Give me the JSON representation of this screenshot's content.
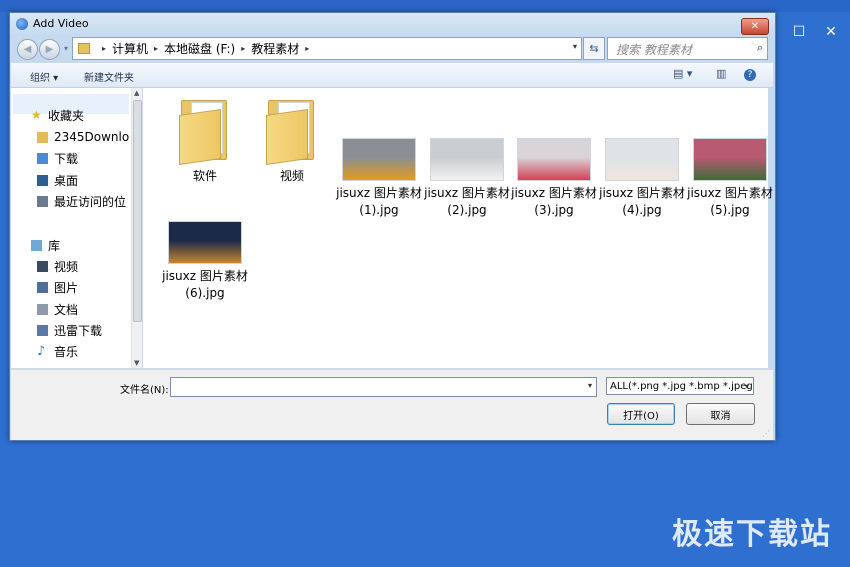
{
  "dialog": {
    "title": "Add Video",
    "close_glyph": "✕"
  },
  "nav_buttons": {
    "back": "◀",
    "forward": "▶",
    "dropdown": "▾"
  },
  "address": {
    "crumbs": [
      "计算机",
      "本地磁盘 (F:)",
      "教程素材"
    ],
    "separator": "▸",
    "dropdown": "▾"
  },
  "refresh_glyph": "⇆",
  "search": {
    "placeholder": "搜索 教程素材",
    "icon": "search-icon"
  },
  "toolbar": {
    "organize": "组织 ▾",
    "new_folder": "新建文件夹",
    "view_icon": "▤ ▾",
    "pane_icon": "▥",
    "help_icon": "?"
  },
  "nav_tree": [
    {
      "label": "收藏夹",
      "icon": "star-icon",
      "color": "#e7b525",
      "top": true
    },
    {
      "label": "2345Downlo",
      "icon": "folder-icon",
      "color": "#e2bd55"
    },
    {
      "label": "下载",
      "icon": "download-folder-icon",
      "color": "#4a8cd1"
    },
    {
      "label": "桌面",
      "icon": "desktop-icon",
      "color": "#2f5d95"
    },
    {
      "label": "最近访问的位",
      "icon": "recent-places-icon",
      "color": "#6b7a8e"
    },
    {
      "label": "库",
      "icon": "libraries-icon",
      "color": "#6fa9d6",
      "top": true
    },
    {
      "label": "视频",
      "icon": "videos-icon",
      "color": "#3a4a5f"
    },
    {
      "label": "图片",
      "icon": "pictures-icon",
      "color": "#4e6f9a"
    },
    {
      "label": "文档",
      "icon": "documents-icon",
      "color": "#8e9aa9"
    },
    {
      "label": "迅雷下载",
      "icon": "thunder-folder-icon",
      "color": "#5c79a6"
    },
    {
      "label": "音乐",
      "icon": "music-icon",
      "color": "#2a79d2"
    }
  ],
  "files": [
    {
      "label": "软件",
      "kind": "folder"
    },
    {
      "label": "视频",
      "kind": "folder"
    },
    {
      "label": "jisuxz 图片素材 (1).jpg",
      "kind": "image",
      "colors": [
        "#8a8f95",
        "#e39a1c"
      ]
    },
    {
      "label": "jisuxz 图片素材 (2).jpg",
      "kind": "image",
      "colors": [
        "#c9ccd0",
        "#f2f2f2"
      ]
    },
    {
      "label": "jisuxz 图片素材 (3).jpg",
      "kind": "image",
      "colors": [
        "#d9d4d9",
        "#d14054"
      ]
    },
    {
      "label": "jisuxz 图片素材 (4).jpg",
      "kind": "image",
      "colors": [
        "#dfe3e6",
        "#f1e4de"
      ]
    },
    {
      "label": "jisuxz 图片素材 (5).jpg",
      "kind": "image",
      "colors": [
        "#b85a72",
        "#3e6a3a"
      ]
    },
    {
      "label": "jisuxz 图片素材 (6).jpg",
      "kind": "image",
      "colors": [
        "#1c2a4a",
        "#c7862e"
      ]
    }
  ],
  "bottom": {
    "filename_label": "文件名(N):",
    "filename_value": "",
    "filetype_value": "ALL(*.png *.jpg *.bmp *.jpeg",
    "open_button": "打开(O)",
    "cancel_button": "取消",
    "dropdown": "▾"
  },
  "background": {
    "maximize_glyph": "☐",
    "close_glyph": "✕",
    "watermark": "极速下载站"
  }
}
